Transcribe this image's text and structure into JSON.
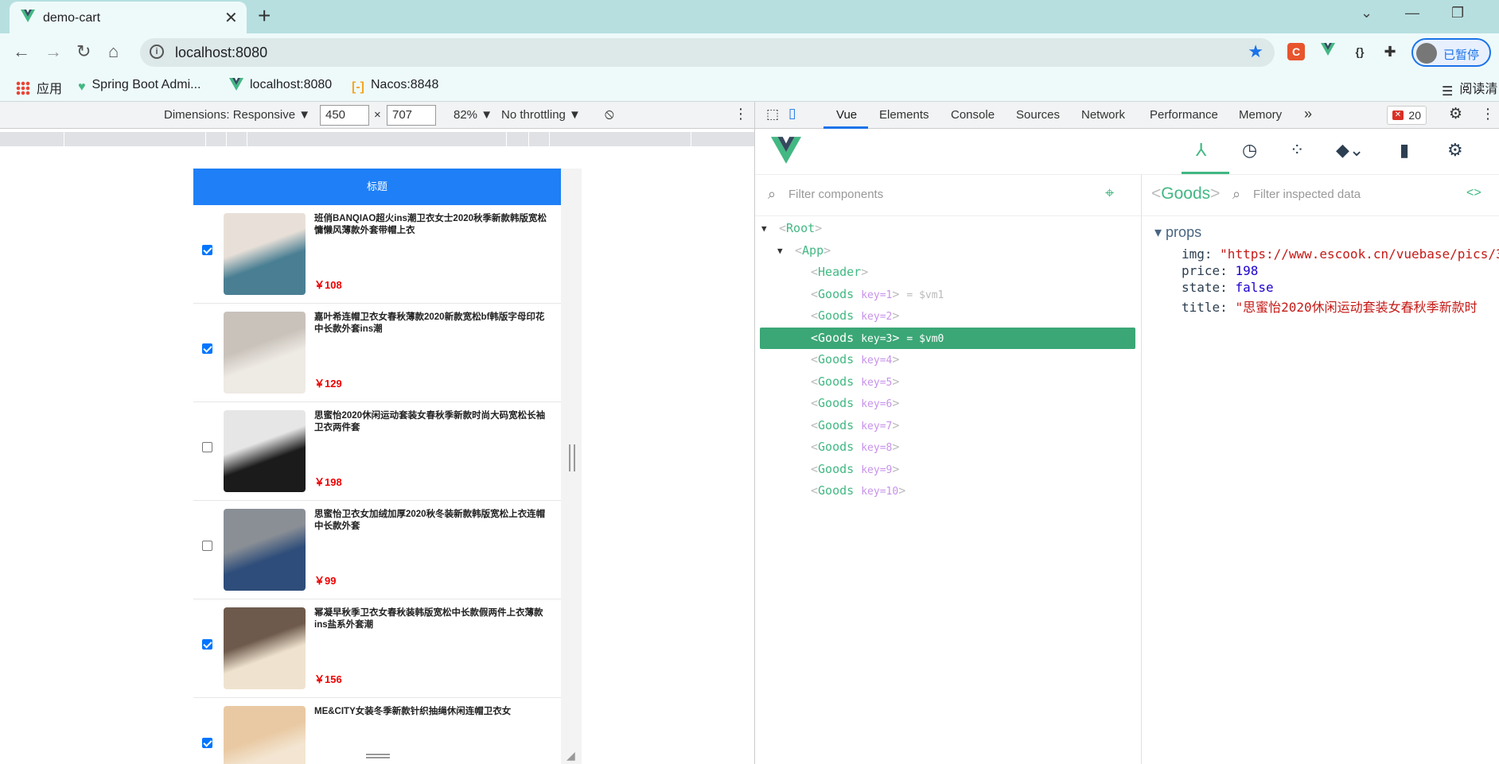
{
  "browser": {
    "tab_title": "demo-cart",
    "url": "localhost:8080",
    "profile_label": "已暂停",
    "reader_label": "阅读清",
    "bookmarks": [
      {
        "label": "应用",
        "icon": "apps-grid-icon"
      },
      {
        "label": "Spring Boot Admi...",
        "icon": "heartbeat-icon"
      },
      {
        "label": "localhost:8080",
        "icon": "vue-logo-icon"
      },
      {
        "label": "Nacos:8848",
        "icon": "nacos-icon"
      }
    ]
  },
  "device_toolbar": {
    "dimensions_label": "Dimensions: Responsive",
    "width": "450",
    "height": "707",
    "times": "×",
    "zoom": "82%",
    "throttling": "No throttling"
  },
  "app": {
    "header_title": "标题",
    "goods": [
      {
        "title": "班俏BANQIAO超火ins潮卫衣女士2020秋季新款韩版宽松慵懒风薄款外套带帽上衣",
        "price": "￥108",
        "checked": true,
        "colors": [
          "#e8e0d8",
          "#4a7f93"
        ]
      },
      {
        "title": "嘉叶希连帽卫衣女春秋薄款2020新款宽松bf韩版字母印花中长款外套ins潮",
        "price": "￥129",
        "checked": true,
        "colors": [
          "#c9c2bb",
          "#eeeae4"
        ]
      },
      {
        "title": "思蜜怡2020休闲运动套装女春秋季新款时尚大码宽松长袖卫衣两件套",
        "price": "￥198",
        "checked": false,
        "colors": [
          "#e6e6e6",
          "#1b1b1b"
        ]
      },
      {
        "title": "思蜜怡卫衣女加绒加厚2020秋冬装新款韩版宽松上衣连帽中长款外套",
        "price": "￥99",
        "checked": false,
        "colors": [
          "#8a8f96",
          "#2e4d7a"
        ]
      },
      {
        "title": "幂凝早秋季卫衣女春秋装韩版宽松中长款假两件上衣薄款ins盐系外套潮",
        "price": "￥156",
        "checked": true,
        "colors": [
          "#6e5a4c",
          "#efe3cf"
        ]
      },
      {
        "title": "ME&CITY女装冬季新款针织抽绳休闲连帽卫衣女",
        "price": "",
        "checked": true,
        "colors": [
          "#e9c9a3",
          "#f3e5d1"
        ]
      }
    ]
  },
  "devtools": {
    "tabs": [
      "Vue",
      "Elements",
      "Console",
      "Sources",
      "Network",
      "Performance",
      "Memory"
    ],
    "more": "»",
    "error_count": "20",
    "filter_components_placeholder": "Filter components",
    "filter_inspected_placeholder": "Filter inspected data",
    "selected_component": "Goods",
    "props_section": "props",
    "props": [
      {
        "key": "img",
        "value": "\"https://www.escook.cn/vuebase/pics/3",
        "kind": "s"
      },
      {
        "key": "price",
        "value": "198",
        "kind": "n"
      },
      {
        "key": "state",
        "value": "false",
        "kind": "bo"
      },
      {
        "key": "title",
        "value": "\"思蜜怡2020休闲运动套装女春秋季新款时",
        "kind": "s"
      }
    ],
    "tree": [
      {
        "name": "Root",
        "depth": 0,
        "arrow": "▼",
        "key": "",
        "vm": "",
        "selected": false
      },
      {
        "name": "App",
        "depth": 1,
        "arrow": "▼",
        "key": "",
        "vm": "",
        "selected": false
      },
      {
        "name": "Header",
        "depth": 2,
        "arrow": "",
        "key": "",
        "vm": "",
        "selected": false
      },
      {
        "name": "Goods",
        "depth": 2,
        "arrow": "",
        "key": "key=1",
        "vm": "= $vm1",
        "selected": false
      },
      {
        "name": "Goods",
        "depth": 2,
        "arrow": "",
        "key": "key=2",
        "vm": "",
        "selected": false
      },
      {
        "name": "Goods",
        "depth": 2,
        "arrow": "",
        "key": "key=3",
        "vm": "= $vm0",
        "selected": true
      },
      {
        "name": "Goods",
        "depth": 2,
        "arrow": "",
        "key": "key=4",
        "vm": "",
        "selected": false
      },
      {
        "name": "Goods",
        "depth": 2,
        "arrow": "",
        "key": "key=5",
        "vm": "",
        "selected": false
      },
      {
        "name": "Goods",
        "depth": 2,
        "arrow": "",
        "key": "key=6",
        "vm": "",
        "selected": false
      },
      {
        "name": "Goods",
        "depth": 2,
        "arrow": "",
        "key": "key=7",
        "vm": "",
        "selected": false
      },
      {
        "name": "Goods",
        "depth": 2,
        "arrow": "",
        "key": "key=8",
        "vm": "",
        "selected": false
      },
      {
        "name": "Goods",
        "depth": 2,
        "arrow": "",
        "key": "key=9",
        "vm": "",
        "selected": false
      },
      {
        "name": "Goods",
        "depth": 2,
        "arrow": "",
        "key": "key=10",
        "vm": "",
        "selected": false
      }
    ]
  },
  "colors": {
    "vue_green": "#42b883",
    "selected_row": "#3ba776",
    "app_header": "#1e7ff7",
    "price_red": "#e00000",
    "chrome_frame": "#b7dfe0"
  }
}
